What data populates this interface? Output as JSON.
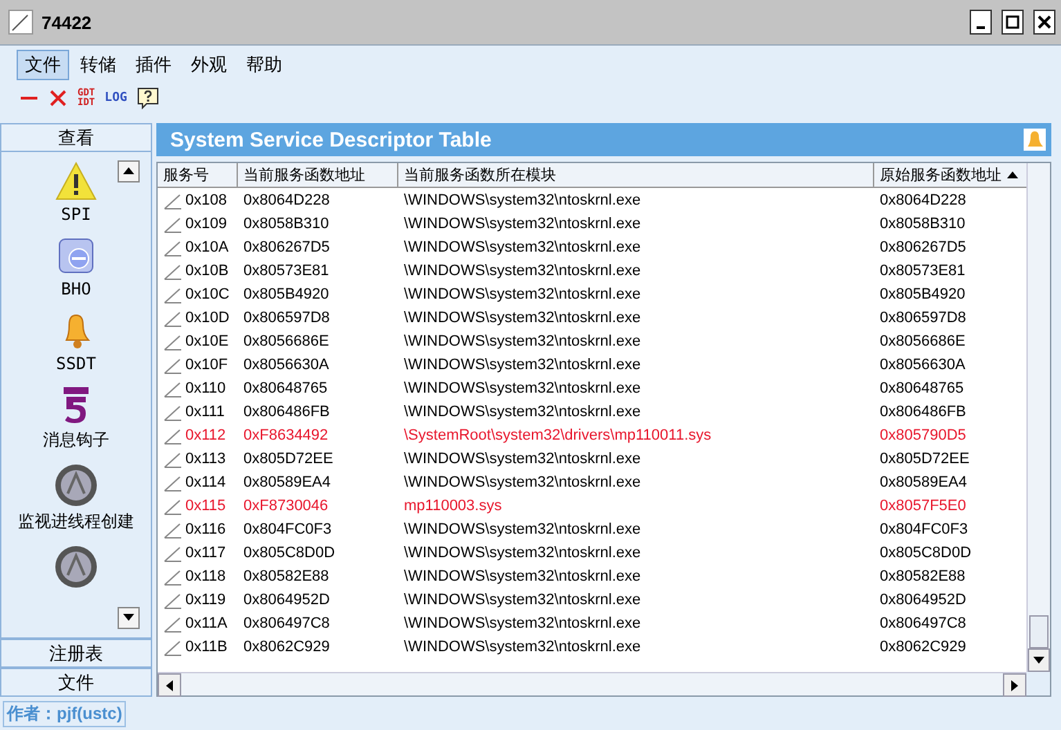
{
  "window": {
    "title": "74422"
  },
  "menu": [
    {
      "label": "文件",
      "selected": true
    },
    {
      "label": "转储",
      "selected": false
    },
    {
      "label": "插件",
      "selected": false
    },
    {
      "label": "外观",
      "selected": false
    },
    {
      "label": "帮助",
      "selected": false
    }
  ],
  "toolbar": [
    {
      "kind": "dash"
    },
    {
      "kind": "cross"
    },
    {
      "kind": "stack",
      "lines": [
        "GDT",
        "IDT"
      ]
    },
    {
      "kind": "label",
      "text": "LOG"
    },
    {
      "kind": "help"
    }
  ],
  "sidebar": {
    "header": "查看",
    "items": [
      {
        "kind": "warning",
        "label": "SPI"
      },
      {
        "kind": "folder",
        "label": "BHO"
      },
      {
        "kind": "bell",
        "label": "SSDT"
      },
      {
        "kind": "hook",
        "label": "消息钩子"
      },
      {
        "kind": "orb",
        "label": "监视进线程创建"
      },
      {
        "kind": "orb"
      }
    ],
    "sections": [
      "注册表",
      "文件"
    ],
    "author": "作者：pjf(ustc)"
  },
  "panel": {
    "title": "System Service Descriptor Table",
    "table": {
      "columns": [
        "服务号",
        "当前服务函数地址",
        "当前服务函数所在模块",
        "原始服务函数地址"
      ],
      "rows": [
        {
          "cells": [
            "0x108",
            "0x8064D228",
            "\\WINDOWS\\system32\\ntoskrnl.exe",
            "0x8064D228"
          ],
          "flagged": false
        },
        {
          "cells": [
            "0x109",
            "0x8058B310",
            "\\WINDOWS\\system32\\ntoskrnl.exe",
            "0x8058B310"
          ],
          "flagged": false
        },
        {
          "cells": [
            "0x10A",
            "0x806267D5",
            "\\WINDOWS\\system32\\ntoskrnl.exe",
            "0x806267D5"
          ],
          "flagged": false
        },
        {
          "cells": [
            "0x10B",
            "0x80573E81",
            "\\WINDOWS\\system32\\ntoskrnl.exe",
            "0x80573E81"
          ],
          "flagged": false
        },
        {
          "cells": [
            "0x10C",
            "0x805B4920",
            "\\WINDOWS\\system32\\ntoskrnl.exe",
            "0x805B4920"
          ],
          "flagged": false
        },
        {
          "cells": [
            "0x10D",
            "0x806597D8",
            "\\WINDOWS\\system32\\ntoskrnl.exe",
            "0x806597D8"
          ],
          "flagged": false
        },
        {
          "cells": [
            "0x10E",
            "0x8056686E",
            "\\WINDOWS\\system32\\ntoskrnl.exe",
            "0x8056686E"
          ],
          "flagged": false
        },
        {
          "cells": [
            "0x10F",
            "0x8056630A",
            "\\WINDOWS\\system32\\ntoskrnl.exe",
            "0x8056630A"
          ],
          "flagged": false
        },
        {
          "cells": [
            "0x110",
            "0x80648765",
            "\\WINDOWS\\system32\\ntoskrnl.exe",
            "0x80648765"
          ],
          "flagged": false
        },
        {
          "cells": [
            "0x111",
            "0x806486FB",
            "\\WINDOWS\\system32\\ntoskrnl.exe",
            "0x806486FB"
          ],
          "flagged": false
        },
        {
          "cells": [
            "0x112",
            "0xF8634492",
            "\\SystemRoot\\system32\\drivers\\mp110011.sys",
            "0x805790D5"
          ],
          "flagged": true
        },
        {
          "cells": [
            "0x113",
            "0x805D72EE",
            "\\WINDOWS\\system32\\ntoskrnl.exe",
            "0x805D72EE"
          ],
          "flagged": false
        },
        {
          "cells": [
            "0x114",
            "0x80589EA4",
            "\\WINDOWS\\system32\\ntoskrnl.exe",
            "0x80589EA4"
          ],
          "flagged": false
        },
        {
          "cells": [
            "0x115",
            "0xF8730046",
            "mp110003.sys",
            "0x8057F5E0"
          ],
          "flagged": true
        },
        {
          "cells": [
            "0x116",
            "0x804FC0F3",
            "\\WINDOWS\\system32\\ntoskrnl.exe",
            "0x804FC0F3"
          ],
          "flagged": false
        },
        {
          "cells": [
            "0x117",
            "0x805C8D0D",
            "\\WINDOWS\\system32\\ntoskrnl.exe",
            "0x805C8D0D"
          ],
          "flagged": false
        },
        {
          "cells": [
            "0x118",
            "0x80582E88",
            "\\WINDOWS\\system32\\ntoskrnl.exe",
            "0x80582E88"
          ],
          "flagged": false
        },
        {
          "cells": [
            "0x119",
            "0x8064952D",
            "\\WINDOWS\\system32\\ntoskrnl.exe",
            "0x8064952D"
          ],
          "flagged": false
        },
        {
          "cells": [
            "0x11A",
            "0x806497C8",
            "\\WINDOWS\\system32\\ntoskrnl.exe",
            "0x806497C8"
          ],
          "flagged": false
        },
        {
          "cells": [
            "0x11B",
            "0x8062C929",
            "\\WINDOWS\\system32\\ntoskrnl.exe",
            "0x8062C929"
          ],
          "flagged": false
        }
      ]
    }
  }
}
